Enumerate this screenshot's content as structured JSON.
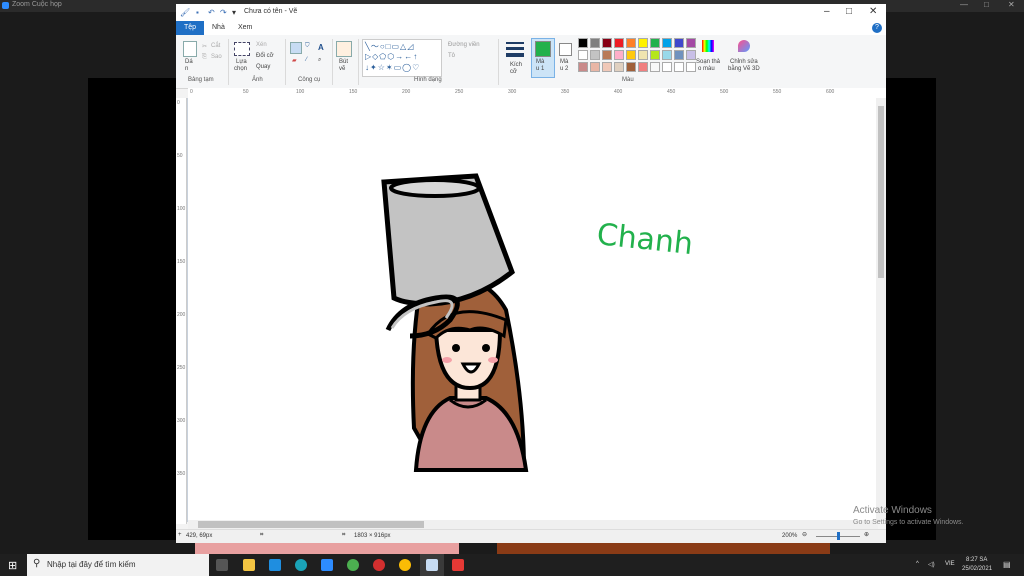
{
  "zoom": {
    "window_title": "Zoom Cuộc họp"
  },
  "paint": {
    "window_title": "Chưa có tên - Vẽ",
    "tabs": [
      "Tệp",
      "Nhà",
      "Xem"
    ],
    "clipboard": {
      "paste": "Dá",
      "paste_sub": "n",
      "cut": "Cắt",
      "copy": "Sao",
      "label": "Bảng tạm"
    },
    "image": {
      "select": "Lựa",
      "select_sub": "chọn",
      "crop": "Xén",
      "resize": "Đổi cỡ",
      "rotate": "Quay",
      "label": "Ảnh"
    },
    "tools": {
      "label": "Công cụ"
    },
    "brushes": {
      "text": "Bút",
      "text_sub": "vẽ"
    },
    "shapes": {
      "outline": "Đường viền",
      "fill": "Tô",
      "label": "Hình dạng"
    },
    "size": {
      "text": "Kích",
      "text_sub": "cỡ"
    },
    "color1": {
      "text": "Mà",
      "text_sub": "u 1"
    },
    "color2": {
      "text": "Mà",
      "text_sub": "u 2"
    },
    "colors_label": "Màu",
    "edit_colors": {
      "text": "Soạn thả",
      "text_sub": "o màu"
    },
    "paint3d": {
      "text": "Chỉnh sửa",
      "text_sub": "bằng Vẽ 3D"
    },
    "ruler_h": [
      "0",
      "50",
      "100",
      "150",
      "200",
      "250",
      "300",
      "350",
      "400",
      "450",
      "500",
      "550",
      "600"
    ],
    "ruler_v": [
      "0",
      "50",
      "100",
      "150",
      "200",
      "250",
      "300",
      "350"
    ],
    "status": {
      "cursor": "429, 69px",
      "size": "1803 × 916px",
      "zoom": "200%"
    },
    "drawing_text": "Chanh"
  },
  "palette": [
    "#000000",
    "#7f7f7f",
    "#880015",
    "#ed1c24",
    "#ff7f27",
    "#fff200",
    "#22b14c",
    "#00a2e8",
    "#3f48cc",
    "#a349a4",
    "#ffffff",
    "#c3c3c3",
    "#b97a57",
    "#ffaec9",
    "#ffc90e",
    "#efe4b0",
    "#b5e61d",
    "#99d9ea",
    "#7092be",
    "#c8bfe7",
    "#c98a8a",
    "#e8b6a6",
    "#f0c8b8",
    "#e0d0c0",
    "#a0603a",
    "#f08080",
    "#f8f8f8",
    "#ffffff",
    "#ffffff",
    "#ffffff"
  ],
  "colors": {
    "color1": "#22b14c",
    "color2": "#ffffff"
  },
  "watermark": {
    "title": "Activate Windows",
    "subtitle": "Go to Settings to activate Windows."
  },
  "taskbar": {
    "search_placeholder": "Nhập tại đây để tìm kiếm",
    "lang": "VIE",
    "time": "8:27 SA",
    "date": "25/02/2021"
  }
}
